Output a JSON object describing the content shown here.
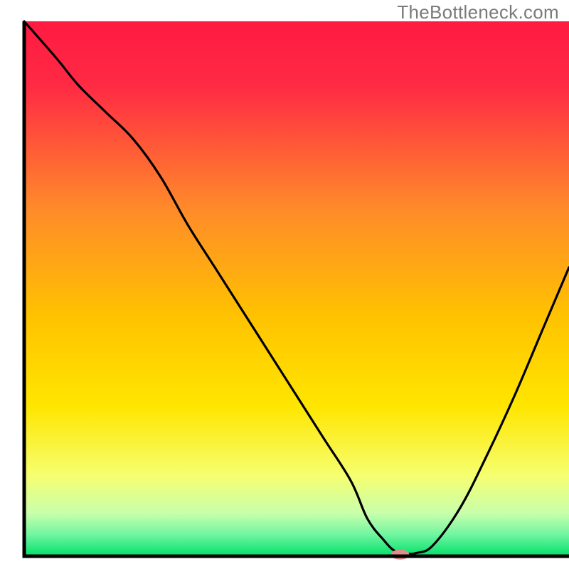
{
  "watermark": "TheBottleneck.com",
  "chart_data": {
    "type": "line",
    "title": "",
    "xlabel": "",
    "ylabel": "",
    "xlim": [
      0,
      100
    ],
    "ylim": [
      0,
      100
    ],
    "x": [
      0,
      6,
      10,
      15,
      20,
      25,
      30,
      35,
      40,
      45,
      50,
      55,
      60,
      63,
      66,
      68,
      70,
      72,
      75,
      80,
      85,
      90,
      95,
      100
    ],
    "values": [
      100,
      93,
      88,
      83,
      78,
      71,
      62,
      54,
      46,
      38,
      30,
      22,
      14,
      7,
      3,
      1,
      0.5,
      0.6,
      2,
      9,
      19,
      30,
      42,
      54
    ],
    "colors": {
      "background_gradient_top": "#ff1a42",
      "background_gradient_mid": "#ffd200",
      "background_gradient_bottom": "#00e068",
      "line_color": "#000000",
      "axis_color": "#000000",
      "marker_fill": "#e58b8b"
    },
    "marker": {
      "x": 69,
      "y": 0.3,
      "rx": 13,
      "ry": 7
    }
  }
}
